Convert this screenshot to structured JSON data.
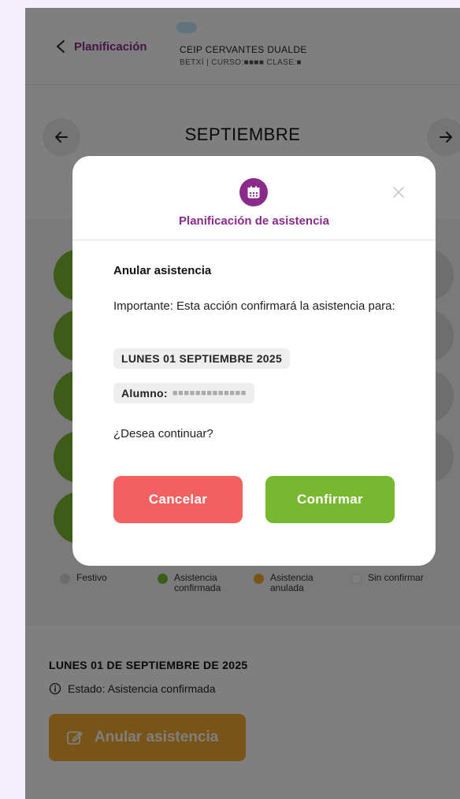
{
  "header": {
    "back_label": "Planificación",
    "school_name": "CEIP CERVANTES DUALDE",
    "school_sub": "BETXÍ | CURSO:■■■■ CLASE:■"
  },
  "calendar": {
    "month": "SEPTIEMBRE"
  },
  "legend": {
    "items": [
      {
        "label": "Festivo",
        "color": "#d8d8d8"
      },
      {
        "label": "Asistencia confirmada",
        "color": "#78b830"
      },
      {
        "label": "Asistencia anulada",
        "color": "#f0a830"
      },
      {
        "label": "Sin confirmar",
        "color": "#ffffff"
      }
    ]
  },
  "details": {
    "date": "LUNES 01 DE SEPTIEMBRE DE 2025",
    "state": "Estado: Asistencia confirmada",
    "action_label": "Anular asistencia"
  },
  "modal": {
    "title": "Planificación de asistencia",
    "heading": "Anular asistencia",
    "text": "Importante: Esta acción confirmará la asistencia para:",
    "date_chip": "LUNES 01 SEPTIEMBRE 2025",
    "student_label": "Alumno:",
    "student_value": "■■■■■■■■■■■■■",
    "question": "¿Desea continuar?",
    "cancel_label": "Cancelar",
    "confirm_label": "Confirmar"
  },
  "colors": {
    "brand_purple": "#8a2b8c",
    "confirm_green": "#78b830",
    "cancel_red": "#f26060",
    "annul_orange": "#f0a830"
  },
  "icons": {
    "back": "chevron-left-icon",
    "prev": "arrow-left-icon",
    "next": "arrow-right-icon",
    "modal": "calendar-icon",
    "close": "close-icon",
    "info": "info-icon",
    "edit": "edit-icon"
  }
}
